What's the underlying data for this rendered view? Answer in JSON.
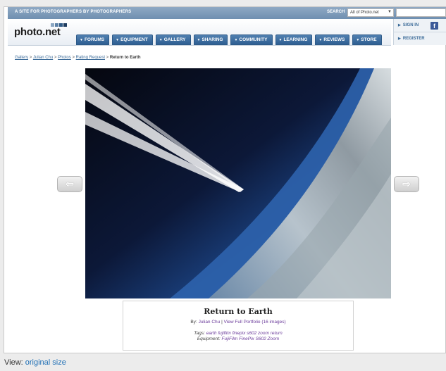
{
  "topbar": {
    "tagline": "A SITE FOR PHOTOGRAPHERS BY PHOTOGRAPHERS",
    "search_label": "SEARCH",
    "search_scope": "All of Photo.net"
  },
  "logo": {
    "text": "photo.net",
    "square_colors": [
      "#8aa6c2",
      "#5b80a6",
      "#2f5a86",
      "#1e3c5f"
    ]
  },
  "nav": {
    "tabs": [
      {
        "label": "FORUMS"
      },
      {
        "label": "EQUIPMENT"
      },
      {
        "label": "GALLERY"
      },
      {
        "label": "SHARING"
      },
      {
        "label": "COMMUNITY"
      },
      {
        "label": "LEARNING"
      },
      {
        "label": "REVIEWS"
      },
      {
        "label": "STORE"
      }
    ]
  },
  "account": {
    "sign_in": "SIGN IN",
    "register": "REGISTER",
    "facebook_icon": "f"
  },
  "breadcrumb": {
    "items": [
      "Gallery",
      "Julian Chu",
      "Photos",
      "Rating Request"
    ],
    "separator": ">",
    "current": "Return to Earth"
  },
  "navigation_arrows": {
    "prev_icon": "left-arrow-icon",
    "next_icon": "right-arrow-icon"
  },
  "photo": {
    "title": "Return to Earth",
    "by_label": "By:",
    "author": "Julian Chu",
    "divider": "|",
    "portfolio_link": "View Full Portfolio (16 images)",
    "tags_label": "Tags:",
    "tags": "earth fujifilm finepix s602 zoom return",
    "equipment_label": "Equipment:",
    "equipment": "FujiFilm FinePix S602 Zoom"
  },
  "footer": {
    "view_label": "View:",
    "view_link": "original size"
  },
  "colors": {
    "accent": "#2f5f92",
    "link": "#3a6a98",
    "visited_link": "#6a3a9a"
  }
}
